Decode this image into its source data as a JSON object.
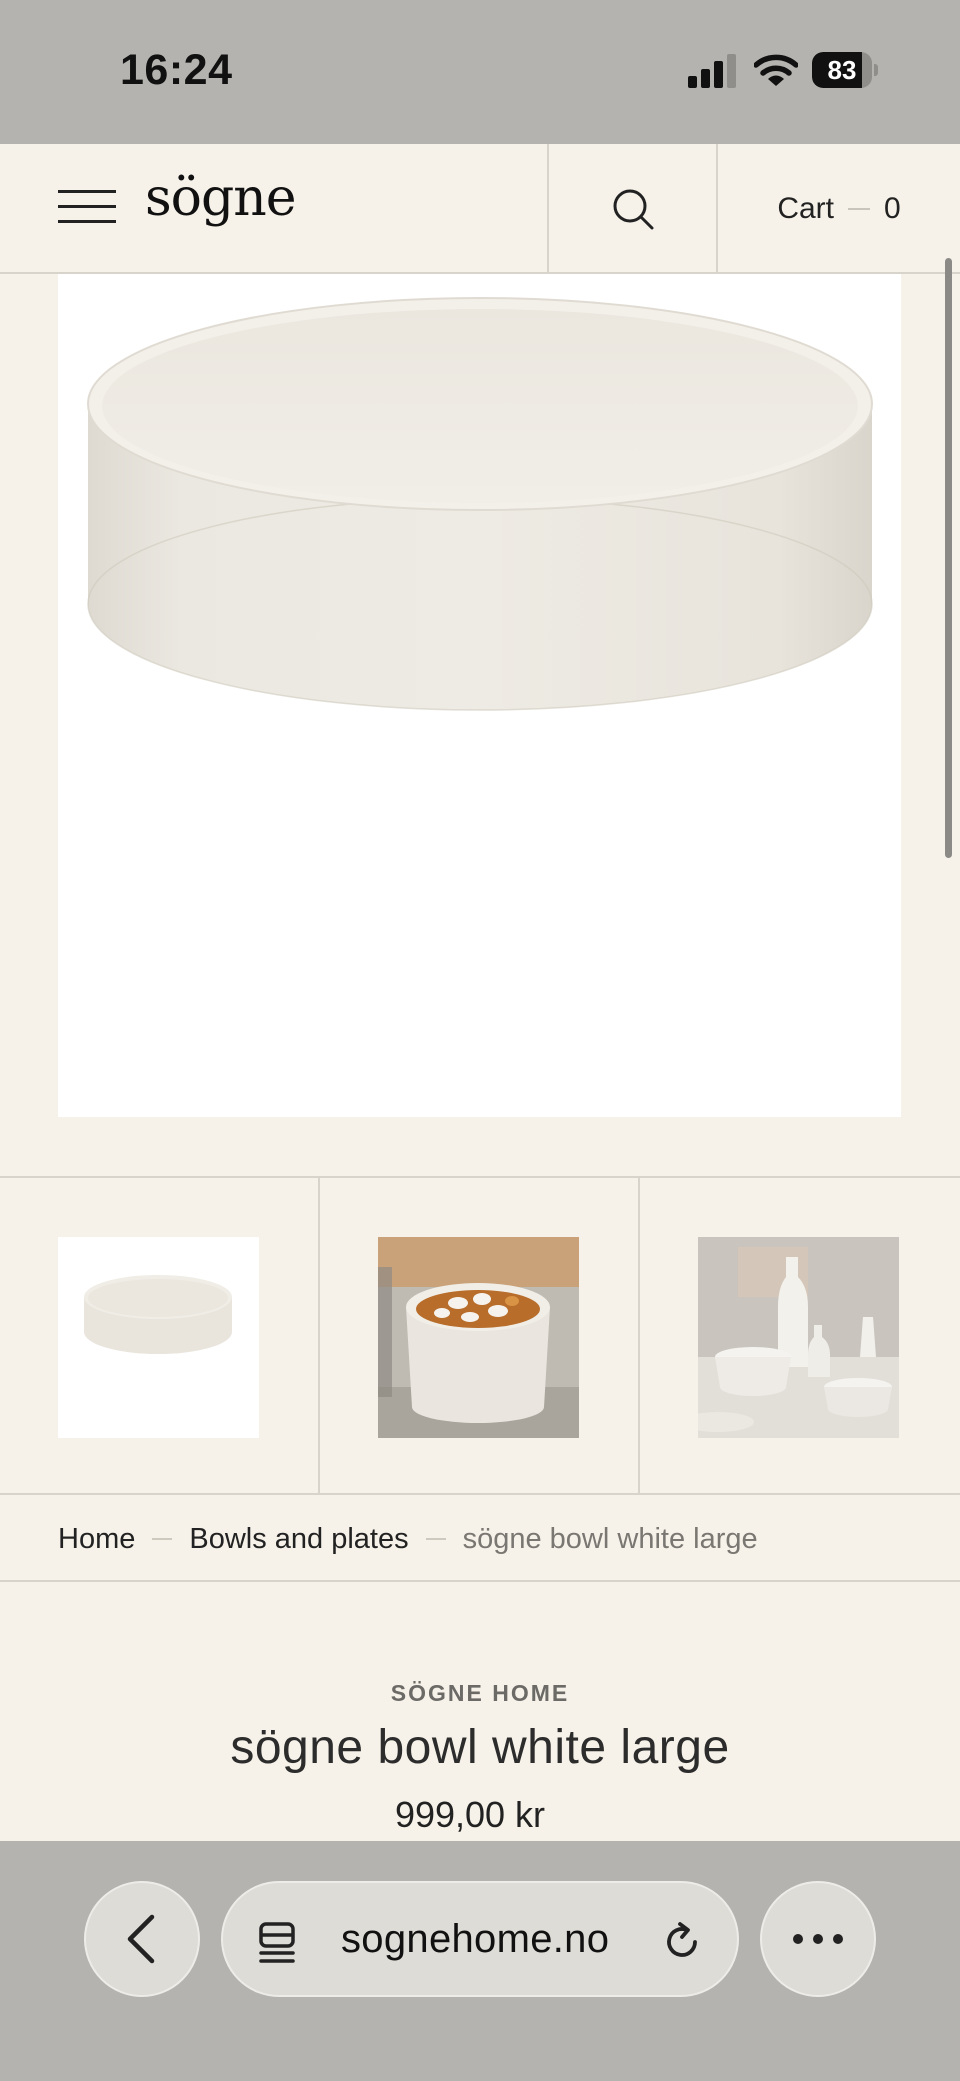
{
  "status_bar": {
    "time": "16:24",
    "battery_level": "83",
    "signal_strength_bars": 3,
    "signal_total_bars": 4
  },
  "header": {
    "logo_text": "sögne",
    "cart_label": "Cart",
    "cart_count": "0"
  },
  "icons": {
    "menu": "hamburger-menu-icon",
    "search": "search-icon",
    "back": "chevron-left-icon",
    "tabs": "tabs-icon",
    "reload": "reload-icon",
    "more": "more-dots-icon"
  },
  "breadcrumb": {
    "items": [
      "Home",
      "Bowls and plates"
    ],
    "current": "sögne bowl white large"
  },
  "product": {
    "brand": "SÖGNE HOME",
    "title": "sögne bowl white large",
    "price": "999,00 kr"
  },
  "browser": {
    "url": "sognehome.no"
  },
  "colors": {
    "page_background": "#f6f2e9",
    "divider": "#d8d4cb",
    "chrome_gray": "#b4b3af",
    "bowl_white": "#ede9e2"
  }
}
